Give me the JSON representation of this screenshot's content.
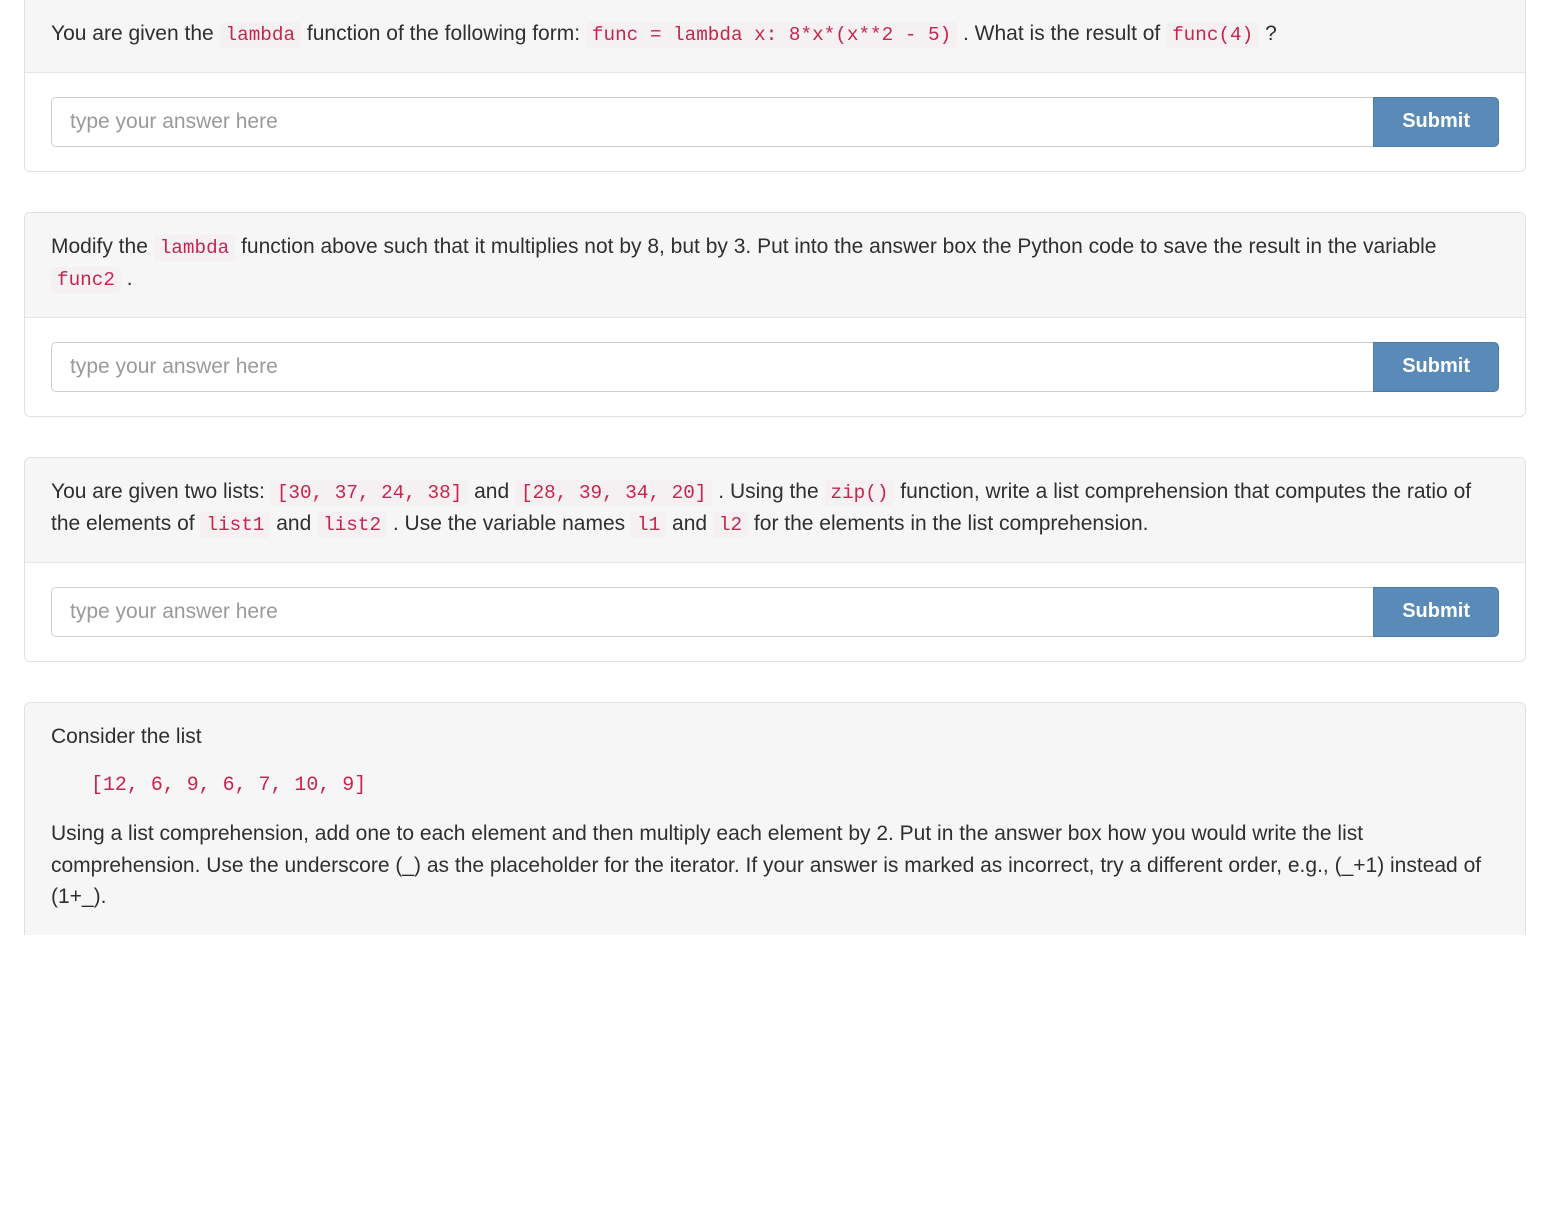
{
  "placeholder": "type your answer here",
  "submit_label": "Submit",
  "questions": [
    {
      "id": "q1",
      "prompt_parts": [
        {
          "t": "text",
          "v": "You are given the "
        },
        {
          "t": "code",
          "v": "lambda"
        },
        {
          "t": "text",
          "v": " function of the following form: "
        },
        {
          "t": "code",
          "v": "func = lambda x: 8*x*(x**2 - 5)"
        },
        {
          "t": "text",
          "v": " . What is the result of "
        },
        {
          "t": "code",
          "v": "func(4)"
        },
        {
          "t": "text",
          "v": " ?"
        }
      ]
    },
    {
      "id": "q2",
      "prompt_parts": [
        {
          "t": "text",
          "v": "Modify the "
        },
        {
          "t": "code",
          "v": "lambda"
        },
        {
          "t": "text",
          "v": " function above such that it multiplies not by 8, but by 3. Put into the answer box the Python code to save the result in the variable "
        },
        {
          "t": "code",
          "v": "func2"
        },
        {
          "t": "text",
          "v": " ."
        }
      ]
    },
    {
      "id": "q3",
      "prompt_parts": [
        {
          "t": "text",
          "v": "You are given two lists: "
        },
        {
          "t": "code",
          "v": "[30, 37, 24, 38]"
        },
        {
          "t": "text",
          "v": " and "
        },
        {
          "t": "code",
          "v": "[28, 39, 34, 20]"
        },
        {
          "t": "text",
          "v": " . Using the "
        },
        {
          "t": "code",
          "v": "zip()"
        },
        {
          "t": "text",
          "v": " function, write a list comprehension that computes the ratio of the elements of "
        },
        {
          "t": "code",
          "v": "list1"
        },
        {
          "t": "text",
          "v": " and "
        },
        {
          "t": "code",
          "v": "list2"
        },
        {
          "t": "text",
          "v": " . Use the variable names "
        },
        {
          "t": "code",
          "v": "l1"
        },
        {
          "t": "text",
          "v": " and "
        },
        {
          "t": "code",
          "v": "l2"
        },
        {
          "t": "text",
          "v": " for the elements in the list comprehension."
        }
      ]
    },
    {
      "id": "q4",
      "intro": "Consider the list",
      "codeblock": "[12, 6, 9, 6, 7, 10, 9]",
      "body": "Using a list comprehension, add one to each element and then multiply each element by 2. Put in the answer box how you would write the list comprehension. Use the underscore (_) as the placeholder for the iterator. If your answer is marked as incorrect, try a different order, e.g., (_+1) instead of (1+_).",
      "has_answer": false
    }
  ]
}
